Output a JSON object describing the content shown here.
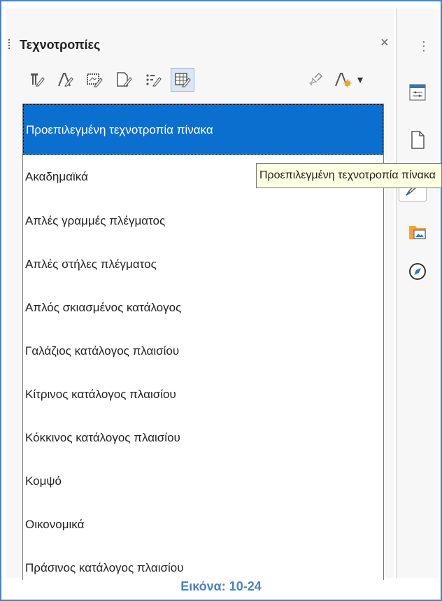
{
  "panel": {
    "title": "Τεχνοτροπίες",
    "close_label": "×"
  },
  "toolbar": {
    "icons": [
      "paragraph-styles-icon",
      "character-styles-icon",
      "frame-styles-icon",
      "page-styles-icon",
      "list-styles-icon",
      "table-styles-icon",
      "fill-format-icon",
      "style-actions-icon"
    ],
    "dropdown_label": "▾"
  },
  "styles_list": [
    "Προεπιλεγμένη τεχνοτροπία πίνακα",
    "Ακαδημαϊκά",
    "Απλές γραμμές πλέγματος",
    "Απλές στήλες πλέγματος",
    "Απλός σκιασμένος κατάλογος",
    "Γαλάζιος κατάλογος πλαισίου",
    "Κίτρινος κατάλογος πλαισίου",
    "Κόκκινος κατάλογος πλαισίου",
    "Κομψό",
    "Οικονομικά",
    "Πράσινος κατάλογος πλαισίου"
  ],
  "tooltip": "Προεπιλεγμένη τεχνοτροπία πίνακα",
  "deck": {
    "menu_label": "⋮"
  },
  "caption": "Εικόνα: 10-24",
  "colors": {
    "selection": "#0b6fd0",
    "caption": "#4f81bd",
    "tooltip_bg": "#ffffe1"
  }
}
